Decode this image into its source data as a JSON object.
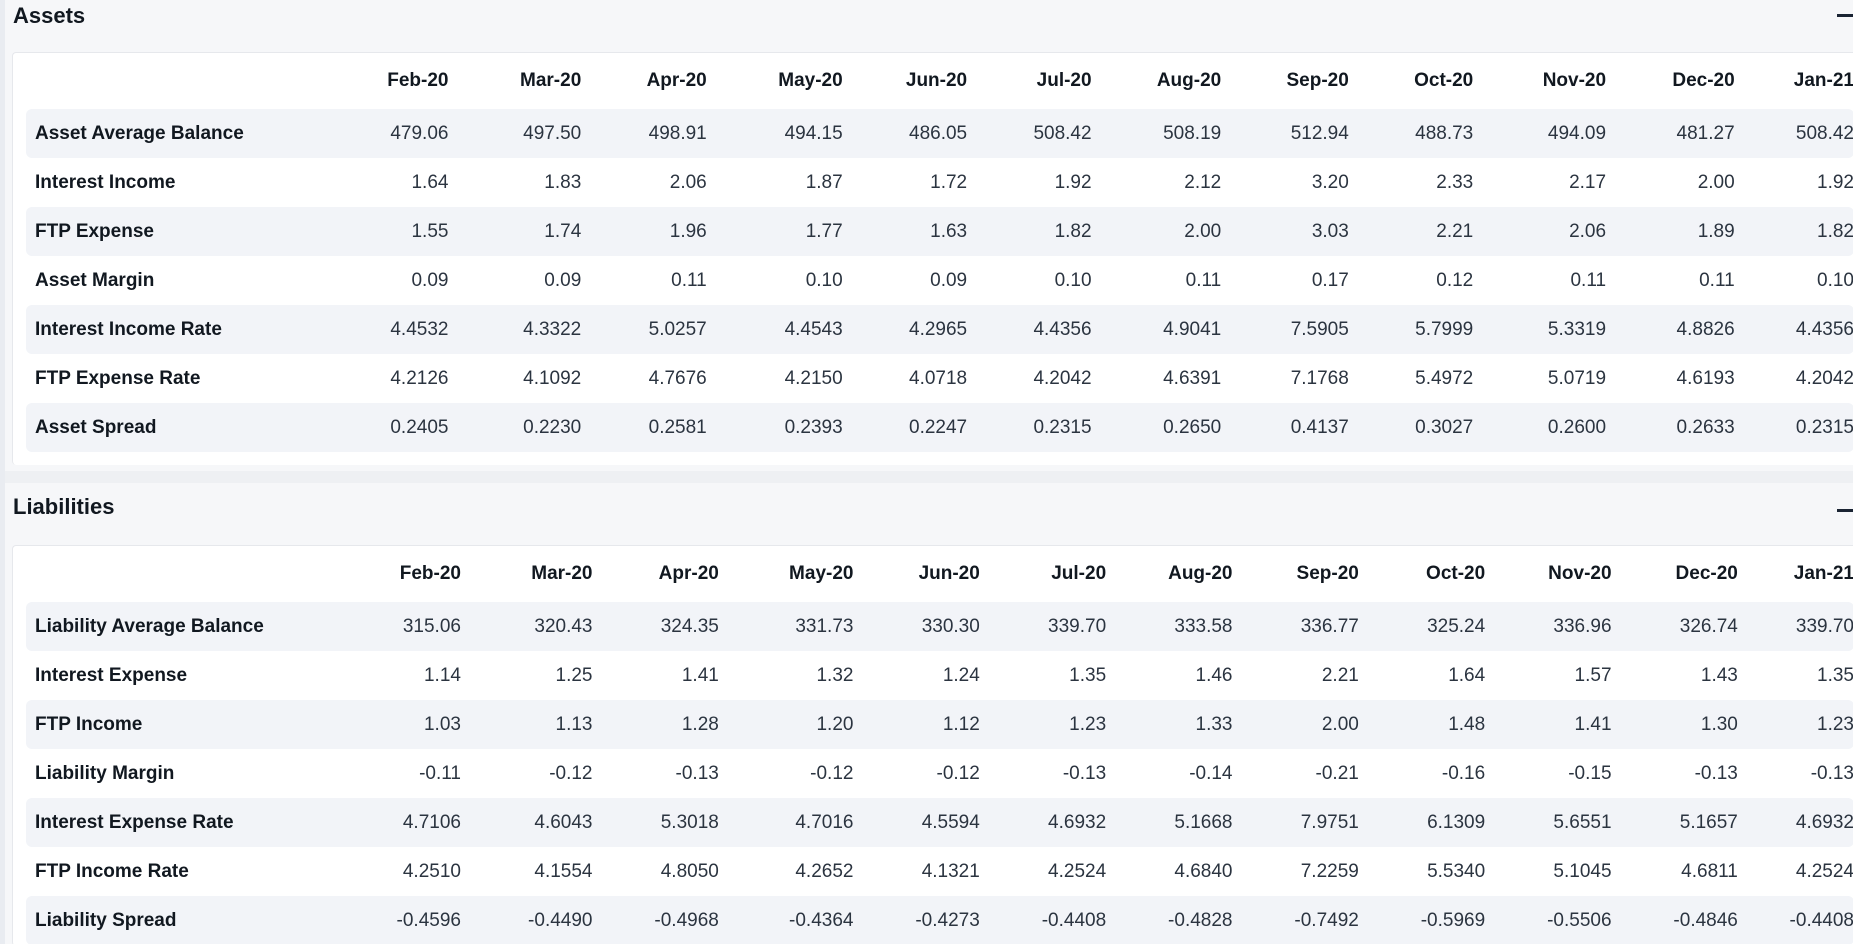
{
  "assets": {
    "title": "Assets",
    "collapse_icon": "minus-icon",
    "columns": [
      "Feb-20",
      "Mar-20",
      "Apr-20",
      "May-20",
      "Jun-20",
      "Jul-20",
      "Aug-20",
      "Sep-20",
      "Oct-20",
      "Nov-20",
      "Dec-20",
      "Jan-21"
    ],
    "rows": [
      {
        "label": "Asset Average Balance",
        "values": [
          "479.06",
          "497.50",
          "498.91",
          "494.15",
          "486.05",
          "508.42",
          "508.19",
          "512.94",
          "488.73",
          "494.09",
          "481.27",
          "508.42"
        ]
      },
      {
        "label": "Interest Income",
        "values": [
          "1.64",
          "1.83",
          "2.06",
          "1.87",
          "1.72",
          "1.92",
          "2.12",
          "3.20",
          "2.33",
          "2.17",
          "2.00",
          "1.92"
        ]
      },
      {
        "label": "FTP Expense",
        "values": [
          "1.55",
          "1.74",
          "1.96",
          "1.77",
          "1.63",
          "1.82",
          "2.00",
          "3.03",
          "2.21",
          "2.06",
          "1.89",
          "1.82"
        ]
      },
      {
        "label": "Asset Margin",
        "values": [
          "0.09",
          "0.09",
          "0.11",
          "0.10",
          "0.09",
          "0.10",
          "0.11",
          "0.17",
          "0.12",
          "0.11",
          "0.11",
          "0.10"
        ]
      },
      {
        "label": "Interest Income Rate",
        "values": [
          "4.4532",
          "4.3322",
          "5.0257",
          "4.4543",
          "4.2965",
          "4.4356",
          "4.9041",
          "7.5905",
          "5.7999",
          "5.3319",
          "4.8826",
          "4.4356"
        ]
      },
      {
        "label": "FTP Expense Rate",
        "values": [
          "4.2126",
          "4.1092",
          "4.7676",
          "4.2150",
          "4.0718",
          "4.2042",
          "4.6391",
          "7.1768",
          "5.4972",
          "5.0719",
          "4.6193",
          "4.2042"
        ]
      },
      {
        "label": "Asset Spread",
        "values": [
          "0.2405",
          "0.2230",
          "0.2581",
          "0.2393",
          "0.2247",
          "0.2315",
          "0.2650",
          "0.4137",
          "0.3027",
          "0.2600",
          "0.2633",
          "0.2315"
        ]
      }
    ]
  },
  "liabilities": {
    "title": "Liabilities",
    "collapse_icon": "minus-icon",
    "columns": [
      "Feb-20",
      "Mar-20",
      "Apr-20",
      "May-20",
      "Jun-20",
      "Jul-20",
      "Aug-20",
      "Sep-20",
      "Oct-20",
      "Nov-20",
      "Dec-20",
      "Jan-21"
    ],
    "rows": [
      {
        "label": "Liability Average Balance",
        "values": [
          "315.06",
          "320.43",
          "324.35",
          "331.73",
          "330.30",
          "339.70",
          "333.58",
          "336.77",
          "325.24",
          "336.96",
          "326.74",
          "339.70"
        ]
      },
      {
        "label": "Interest Expense",
        "values": [
          "1.14",
          "1.25",
          "1.41",
          "1.32",
          "1.24",
          "1.35",
          "1.46",
          "2.21",
          "1.64",
          "1.57",
          "1.43",
          "1.35"
        ]
      },
      {
        "label": "FTP Income",
        "values": [
          "1.03",
          "1.13",
          "1.28",
          "1.20",
          "1.12",
          "1.23",
          "1.33",
          "2.00",
          "1.48",
          "1.41",
          "1.30",
          "1.23"
        ]
      },
      {
        "label": "Liability Margin",
        "values": [
          "-0.11",
          "-0.12",
          "-0.13",
          "-0.12",
          "-0.12",
          "-0.13",
          "-0.14",
          "-0.21",
          "-0.16",
          "-0.15",
          "-0.13",
          "-0.13"
        ]
      },
      {
        "label": "Interest Expense Rate",
        "values": [
          "4.7106",
          "4.6043",
          "5.3018",
          "4.7016",
          "4.5594",
          "4.6932",
          "5.1668",
          "7.9751",
          "6.1309",
          "5.6551",
          "5.1657",
          "4.6932"
        ]
      },
      {
        "label": "FTP Income Rate",
        "values": [
          "4.2510",
          "4.1554",
          "4.8050",
          "4.2652",
          "4.1321",
          "4.2524",
          "4.6840",
          "7.2259",
          "5.5340",
          "5.1045",
          "4.6811",
          "4.2524"
        ]
      },
      {
        "label": "Liability Spread",
        "values": [
          "-0.4596",
          "-0.4490",
          "-0.4968",
          "-0.4364",
          "-0.4273",
          "-0.4408",
          "-0.4828",
          "-0.7492",
          "-0.5969",
          "-0.5506",
          "-0.4846",
          "-0.4408"
        ]
      }
    ]
  }
}
